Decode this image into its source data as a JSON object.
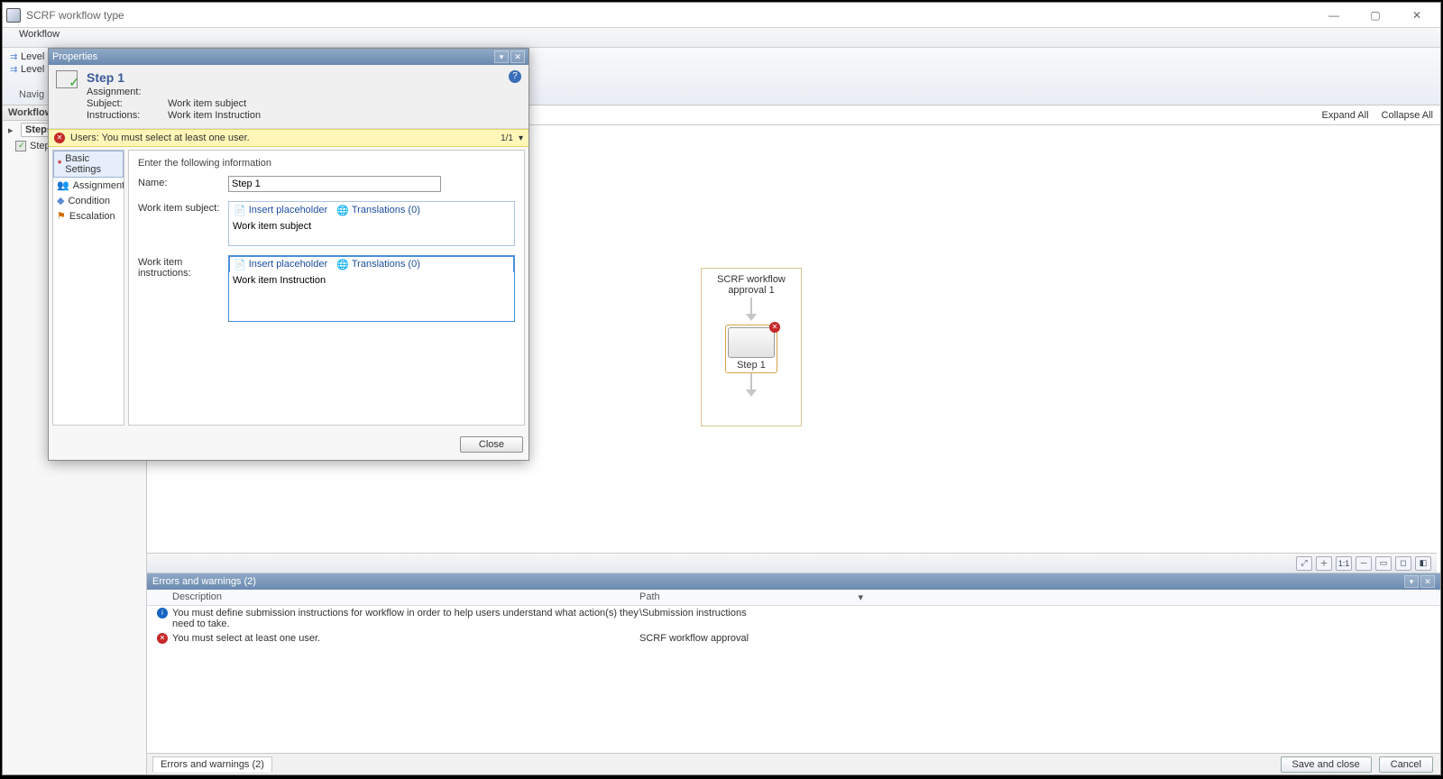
{
  "window": {
    "title": "SCRF workflow type"
  },
  "ribbon": {
    "tab": "Workflow",
    "nav": "Navig"
  },
  "left": {
    "section1": "Workflow",
    "items1": [
      "Level",
      "Level"
    ],
    "section2": "Workflow",
    "steps_label": "Steps",
    "step_item": "Step"
  },
  "canvas_actions": {
    "expand": "Expand All",
    "collapse": "Collapse All"
  },
  "wf": {
    "group_title": "SCRF workflow approval 1",
    "step_node_label": "Step 1"
  },
  "errors": {
    "title": "Errors and warnings (2)",
    "col_desc": "Description",
    "col_path": "Path",
    "rows": [
      {
        "type": "info",
        "desc": "You must define submission instructions for workflow  in order to help users understand what action(s) they need to take.",
        "path": "\\Submission instructions"
      },
      {
        "type": "error",
        "desc": "You must select at least one user.",
        "path": "SCRF workflow approval"
      }
    ],
    "tab": "Errors and warnings (2)"
  },
  "footer": {
    "save": "Save and close",
    "cancel": "Cancel"
  },
  "dialog": {
    "title": "Properties",
    "step_name": "Step 1",
    "kv": {
      "assign_k": "Assignment:",
      "subj_k": "Subject:",
      "subj_v": "Work item subject",
      "instr_k": "Instructions:",
      "instr_v": "Work item Instruction"
    },
    "inline_err": "Users: You must select at least one user.",
    "inline_err_counter": "1/1",
    "nav_items": [
      "Basic Settings",
      "Assignment",
      "Condition",
      "Escalation"
    ],
    "form": {
      "header": "Enter the following information",
      "name_label": "Name:",
      "name_value": "Step 1",
      "subj_label": "Work item subject:",
      "subj_value": "Work item subject",
      "instr_label": "Work item instructions:",
      "instr_value": "Work item Instruction",
      "ph_link": "Insert placeholder",
      "tr_link": "Translations (0)"
    },
    "close": "Close"
  }
}
